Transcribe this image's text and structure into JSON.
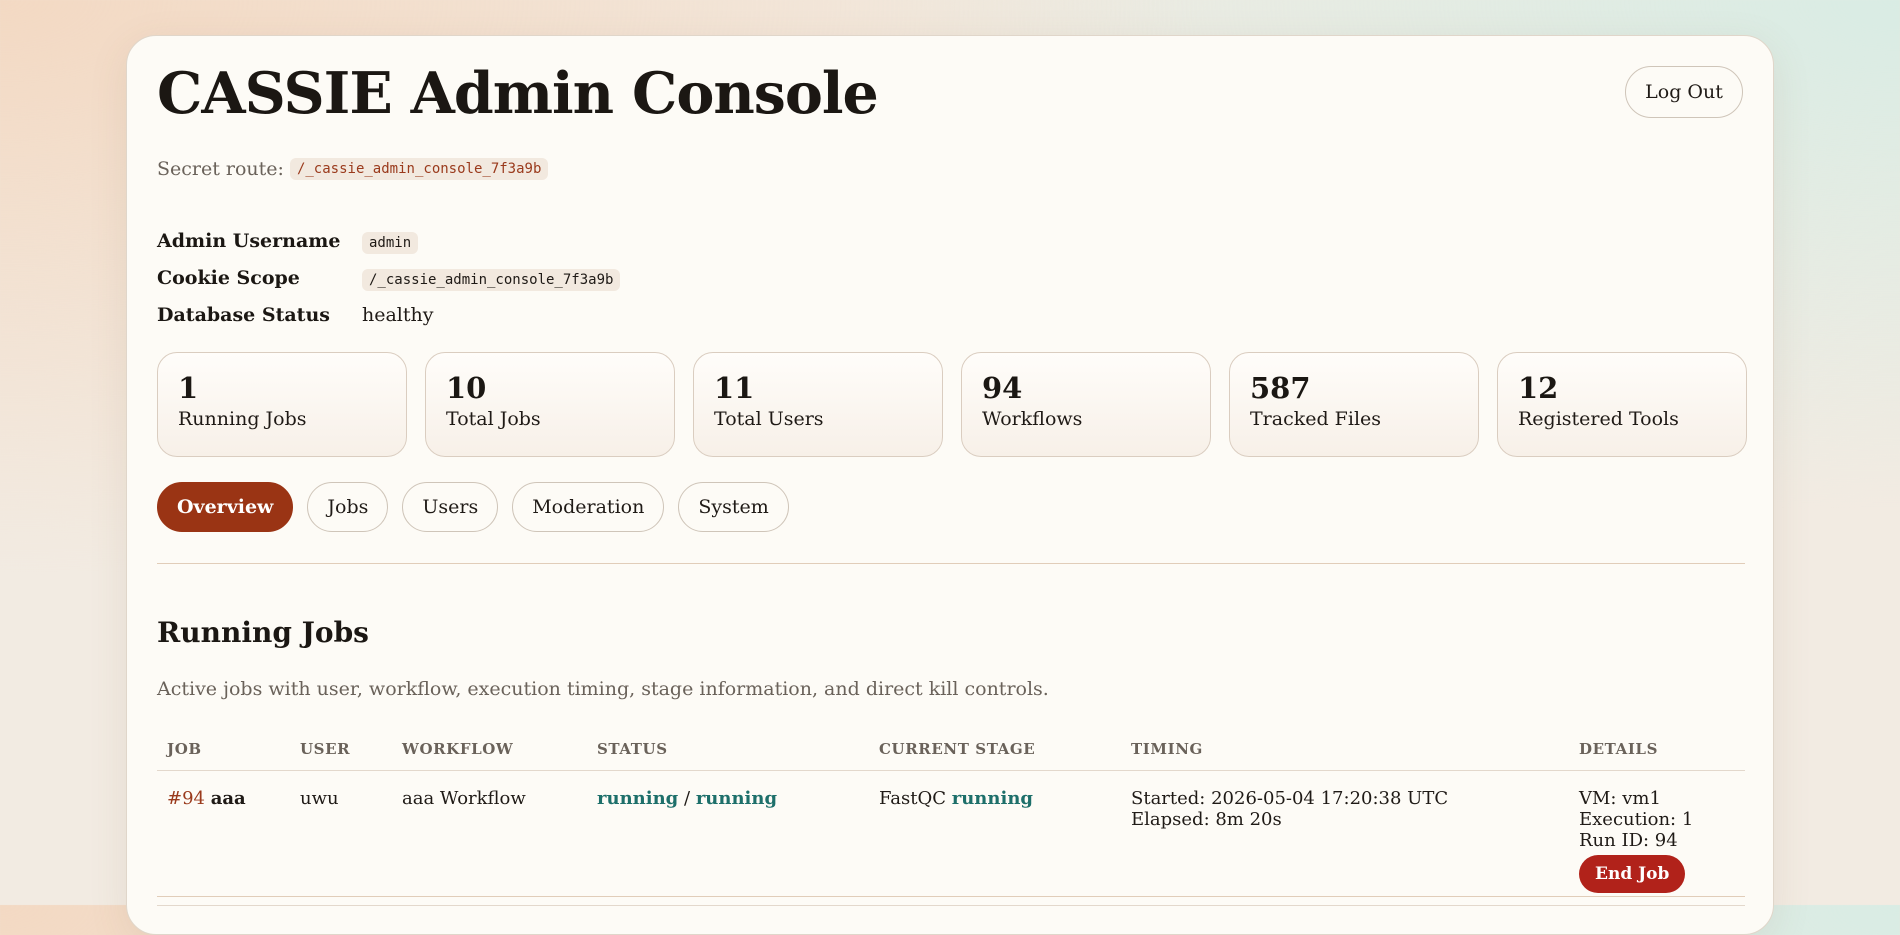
{
  "header": {
    "title": "CASSIE Admin Console",
    "logout_label": "Log Out",
    "route_label": "Secret route:",
    "route_value": "/_cassie_admin_console_7f3a9b"
  },
  "meta": [
    {
      "label": "Admin Username",
      "value": "admin",
      "style": "code"
    },
    {
      "label": "Cookie Scope",
      "value": "/_cassie_admin_console_7f3a9b",
      "style": "code"
    },
    {
      "label": "Database Status",
      "value": "healthy",
      "style": "text"
    }
  ],
  "stats": [
    {
      "value": "1",
      "label": "Running Jobs"
    },
    {
      "value": "10",
      "label": "Total Jobs"
    },
    {
      "value": "11",
      "label": "Total Users"
    },
    {
      "value": "94",
      "label": "Workflows"
    },
    {
      "value": "587",
      "label": "Tracked Files"
    },
    {
      "value": "12",
      "label": "Registered Tools"
    }
  ],
  "tabs": [
    {
      "label": "Overview",
      "active": true
    },
    {
      "label": "Jobs",
      "active": false
    },
    {
      "label": "Users",
      "active": false
    },
    {
      "label": "Moderation",
      "active": false
    },
    {
      "label": "System",
      "active": false
    }
  ],
  "running_jobs": {
    "title": "Running Jobs",
    "description": "Active jobs with user, workflow, execution timing, stage information, and direct kill controls.",
    "columns": [
      "JOB",
      "USER",
      "WORKFLOW",
      "STATUS",
      "CURRENT STAGE",
      "TIMING",
      "DETAILS"
    ],
    "rows": [
      {
        "job_id": "#94",
        "job_name": "aaa",
        "user": "uwu",
        "workflow": "aaa Workflow",
        "status_a": "running",
        "status_sep": "/",
        "status_b": "running",
        "stage_name": "FastQC",
        "stage_status": "running",
        "started": "Started: 2026-05-04 17:20:38 UTC",
        "elapsed": "Elapsed: 8m 20s",
        "vm": "VM: vm1",
        "execution": "Execution: 1",
        "run_id": "Run ID: 94",
        "end_label": "End Job"
      }
    ]
  },
  "colors": {
    "accent": "#9a3414",
    "danger": "#b1221a",
    "status_running": "#1d6f6a",
    "panel_bg": "#fdfbf6"
  }
}
